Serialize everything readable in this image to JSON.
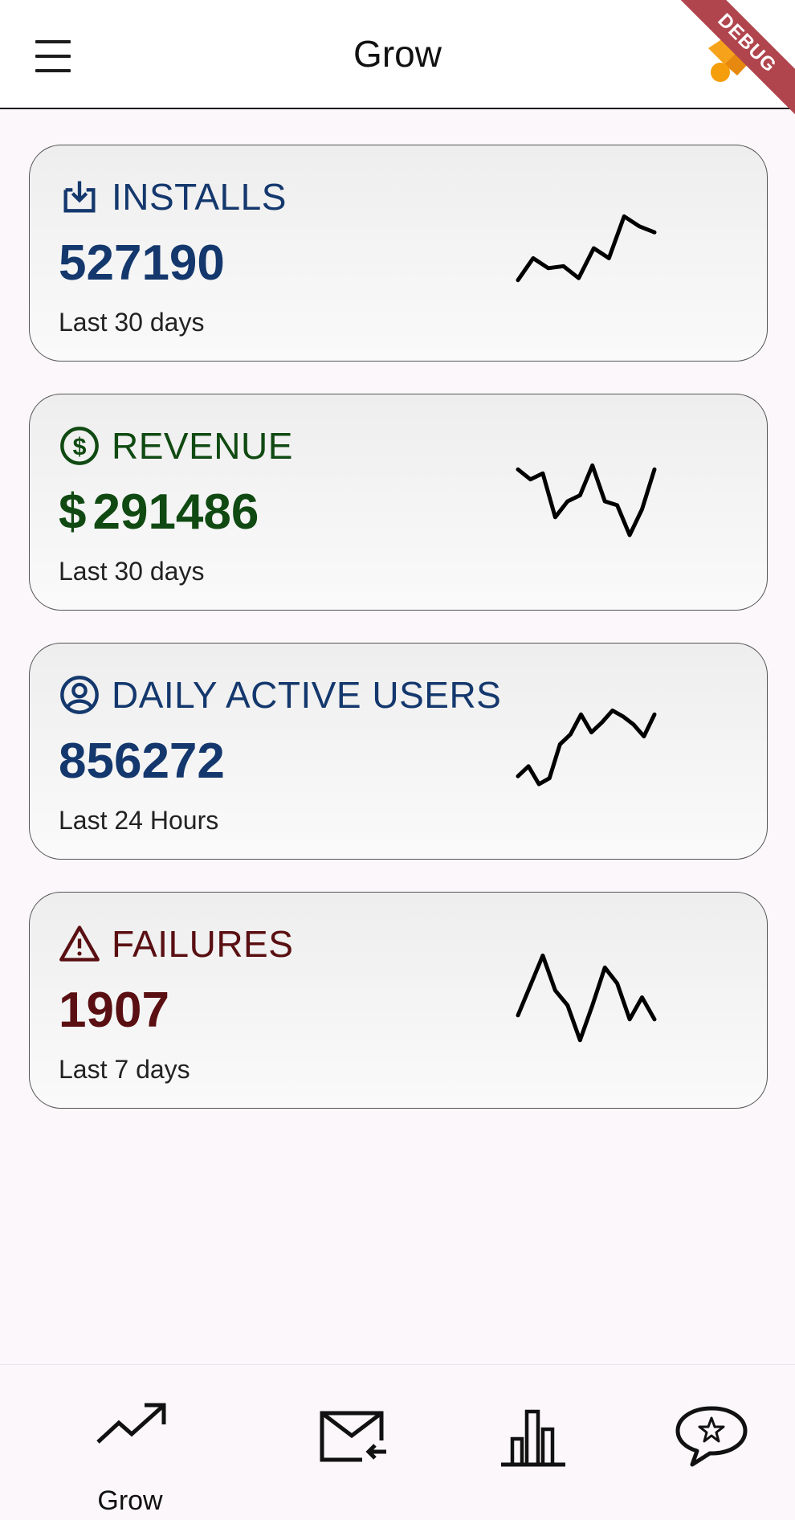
{
  "app_bar": {
    "title": "Grow",
    "menu_icon": "hamburger-menu-icon",
    "debug_banner": "DEBUG"
  },
  "cards": [
    {
      "key": "installs",
      "icon": "download-icon",
      "title": "INSTALLS",
      "value": "527190",
      "subtitle": "Last 30 days",
      "color": "#14386d",
      "sparkline": [
        0.18,
        0.4,
        0.3,
        0.32,
        0.2,
        0.5,
        0.4,
        0.82,
        0.72,
        0.66
      ]
    },
    {
      "key": "revenue",
      "icon": "dollar-circle-icon",
      "title": "REVENUE",
      "currency": "$",
      "value": "291486",
      "subtitle": "Last 30 days",
      "color": "#104a12",
      "sparkline": [
        0.78,
        0.68,
        0.74,
        0.3,
        0.46,
        0.52,
        0.82,
        0.46,
        0.42,
        0.12,
        0.38,
        0.78
      ]
    },
    {
      "key": "dau",
      "icon": "person-circle-icon",
      "title": "DAILY ACTIVE USERS",
      "value": "856272",
      "subtitle": "Last 24 Hours",
      "color": "#14386d",
      "sparkline": [
        0.2,
        0.3,
        0.12,
        0.18,
        0.52,
        0.62,
        0.82,
        0.64,
        0.74,
        0.86,
        0.8,
        0.72,
        0.6,
        0.82
      ]
    },
    {
      "key": "failures",
      "icon": "warning-triangle-icon",
      "title": "FAILURES",
      "value": "1907",
      "subtitle": "Last 7 days",
      "color": "#5a0f12",
      "sparkline": [
        0.3,
        0.6,
        0.9,
        0.55,
        0.4,
        0.05,
        0.4,
        0.78,
        0.62,
        0.26,
        0.48,
        0.26
      ]
    }
  ],
  "bottom_nav": [
    {
      "key": "grow",
      "icon": "trending-up-icon",
      "label": "Grow"
    },
    {
      "key": "inbox",
      "icon": "mail-arrow-icon",
      "label": ""
    },
    {
      "key": "stats",
      "icon": "bar-chart-icon",
      "label": ""
    },
    {
      "key": "reviews",
      "icon": "chat-star-icon",
      "label": ""
    }
  ],
  "colors": {
    "background": "#fcf7fa",
    "installs": "#14386d",
    "revenue": "#104a12",
    "failures": "#5a0f12"
  }
}
